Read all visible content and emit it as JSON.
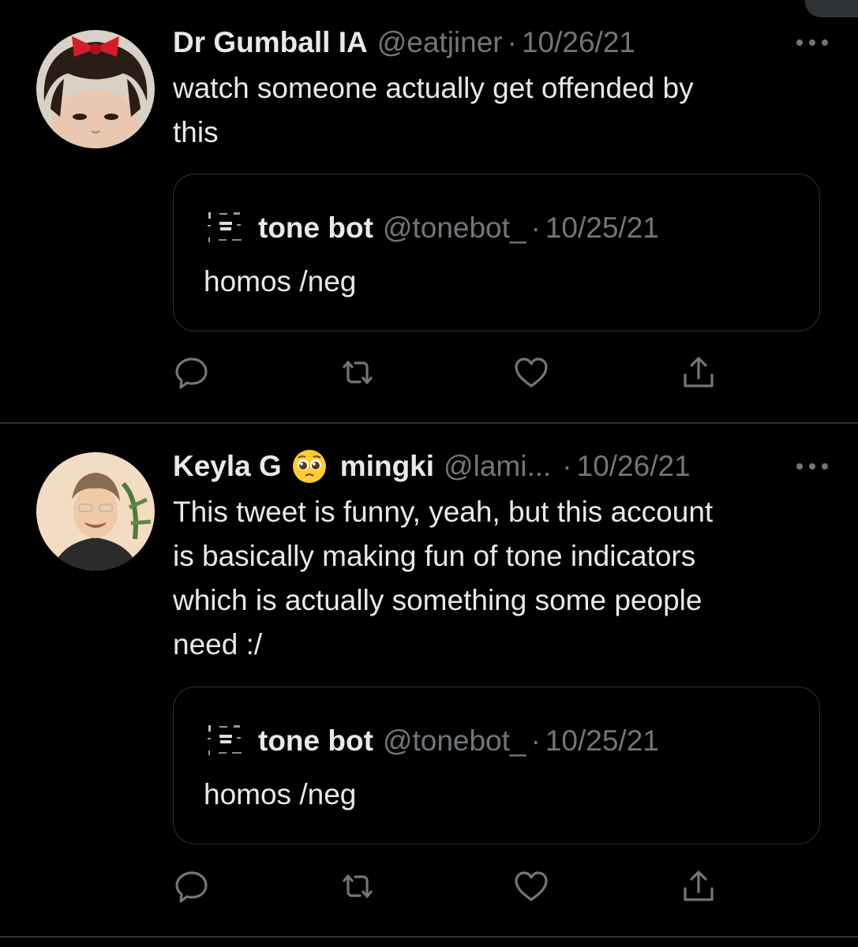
{
  "colors": {
    "background": "#000000",
    "text": "#e7e9ea",
    "muted": "#71767b",
    "border": "#2f3336"
  },
  "tweets": [
    {
      "display_name": "Dr Gumball IA",
      "handle": "@eatjiner",
      "separator": "·",
      "date": "10/26/21",
      "text": "watch someone actually get offended by\nthis",
      "avatar_icon": "avatar-photo-red-bow",
      "quote": {
        "avatar_icon": "tone-bot-logo-icon",
        "display_name": "tone bot",
        "handle": "@tonebot_",
        "separator": "·",
        "date": "10/25/21",
        "text": "homos /neg"
      }
    },
    {
      "display_name": "Keyla G",
      "display_name_suffix": "mingki",
      "emoji_icon": "pleading-face-icon",
      "handle": "@lami...",
      "separator": "·",
      "date": "10/26/21",
      "text": "This tweet is funny, yeah, but this account\nis basically making fun of tone indicators\nwhich is actually something some people\nneed :/",
      "avatar_icon": "avatar-photo-smiling",
      "quote": {
        "avatar_icon": "tone-bot-logo-icon",
        "display_name": "tone bot",
        "handle": "@tonebot_",
        "separator": "·",
        "date": "10/25/21",
        "text": "homos /neg"
      }
    }
  ],
  "actions": [
    "reply-icon",
    "retweet-icon",
    "like-icon",
    "share-icon"
  ]
}
